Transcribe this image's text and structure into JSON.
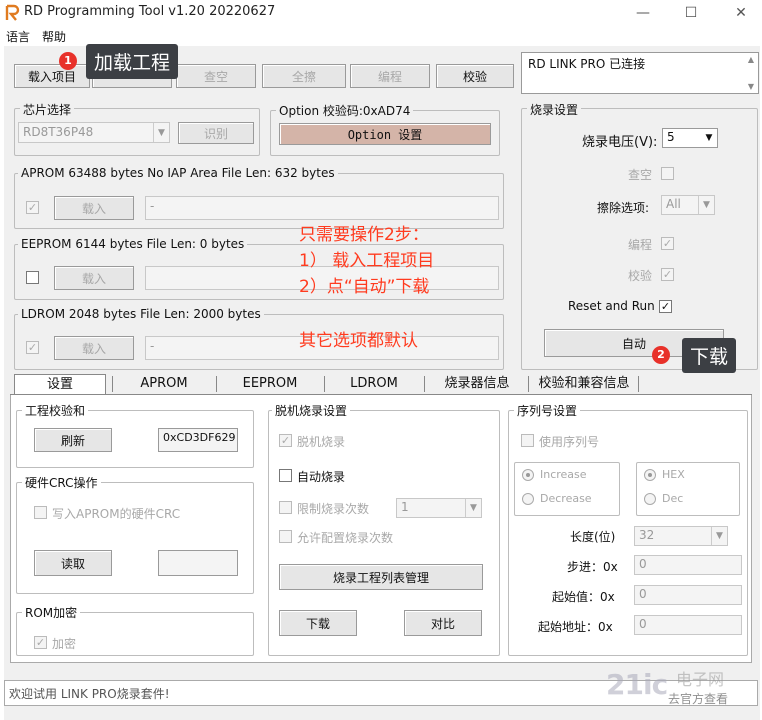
{
  "window": {
    "title": "RD Programming Tool v1.20 20220627",
    "min_icon": "minimize-icon",
    "max_icon": "maximize-icon",
    "close_icon": "close-icon"
  },
  "menu": [
    "语言",
    "帮助"
  ],
  "toolbar": {
    "load_project": "载入项目",
    "blank_check": "查空",
    "full_erase": "全擦",
    "program": "编程",
    "verify": "校验"
  },
  "status_box": "RD LINK PRO 已连接",
  "chip": {
    "group": "芯片选择",
    "selected": "RD8T36P48",
    "identify": "识别"
  },
  "option": {
    "header": "Option  校验码:0xAD74",
    "button": "Option 设置"
  },
  "aprom": {
    "header": "APROM 63488 bytes  No IAP Area    File Len: 632 bytes",
    "load": "载入",
    "path": "-"
  },
  "eeprom": {
    "header": "EEPROM 6144 bytes    File Len: 0 bytes",
    "load": "载入"
  },
  "ldrom": {
    "header": "LDROM 2048 bytes    File Len: 2000 bytes",
    "load": "载入",
    "path": "-"
  },
  "notes": {
    "line1": "只需要操作2步：",
    "line2": "1）  载入工程项目",
    "line3": "2）点“自动”下载",
    "line4": "其它选项都默认"
  },
  "burn": {
    "group": "烧录设置",
    "voltage_label": "烧录电压(V):",
    "voltage": "5",
    "blank_check": "查空",
    "erase_label": "擦除选项:",
    "erase": "All",
    "program": "编程",
    "verify": "校验",
    "reset_run": "Reset and Run",
    "auto": "自动"
  },
  "callouts": {
    "step1_num": "1",
    "step1_text": "加载工程",
    "step2_num": "2",
    "step2_text": "下载"
  },
  "tabs": [
    "设置",
    "APROM",
    "EEPROM",
    "LDROM",
    "烧录器信息",
    "校验和兼容信息"
  ],
  "checksum": {
    "group": "工程校验和",
    "refresh": "刷新",
    "value": "0xCD3DF629"
  },
  "crc": {
    "group": "硬件CRC操作",
    "write": "写入APROM的硬件CRC",
    "read": "读取"
  },
  "rom_encrypt": {
    "group": "ROM加密",
    "encrypt": "加密"
  },
  "offline": {
    "group": "脱机烧录设置",
    "offline_burn": "脱机烧录",
    "auto_burn": "自动烧录",
    "limit_count": "限制烧录次数",
    "limit_value": "1",
    "allow_config": "允许配置烧录次数",
    "manage": "烧录工程列表管理",
    "download": "下载",
    "compare": "对比"
  },
  "serial": {
    "group": "序列号设置",
    "use_serial": "使用序列号",
    "increase": "Increase",
    "decrease": "Decrease",
    "hex": "HEX",
    "dec": "Dec",
    "length_label": "长度(位)",
    "length": "32",
    "step_label": "步进：0x",
    "step": "0",
    "start_label": "起始值：0x",
    "start": "0",
    "addr_label": "起始地址：0x",
    "addr": "0"
  },
  "statusbar": "欢迎试用 LINK PRO烧录套件!",
  "watermark": {
    "text": "电子网",
    "sub": "去官方查看"
  }
}
